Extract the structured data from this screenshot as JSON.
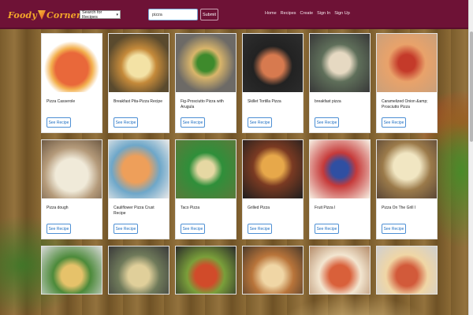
{
  "brand": {
    "part1": "Foody",
    "part2": "Corner"
  },
  "search": {
    "select_value": "Search for Recipes",
    "query": "pizza",
    "submit_label": "Submit"
  },
  "nav": [
    "Home",
    "Recipes",
    "Create",
    "Sign In",
    "Sign Up"
  ],
  "recipes": [
    {
      "title": "Pizza Casserole",
      "button": "See Recipe",
      "image_icon": "recipe-photo"
    },
    {
      "title": "Breakfast Pita-Pizza Recipe",
      "button": "See Recipe",
      "image_icon": "recipe-photo"
    },
    {
      "title": "Fig-Prosciutto Pizza with Arugula",
      "button": "See Recipe",
      "image_icon": "recipe-photo"
    },
    {
      "title": "Skillet Tortilla Pizza",
      "button": "See Recipe",
      "image_icon": "recipe-photo"
    },
    {
      "title": "breakfast pizza",
      "button": "See Recipe",
      "image_icon": "recipe-photo"
    },
    {
      "title": "Caramelized Onion &amp; Prosciutto Pizza",
      "button": "See Recipe",
      "image_icon": "recipe-photo"
    },
    {
      "title": "Pizza dough",
      "button": "See Recipe",
      "image_icon": "recipe-photo"
    },
    {
      "title": "Cauliflower Pizza Crust Recipe",
      "button": "See Recipe",
      "image_icon": "recipe-photo"
    },
    {
      "title": "Taco Pizza",
      "button": "See Recipe",
      "image_icon": "recipe-photo"
    },
    {
      "title": "Grilled Pizza",
      "button": "See Recipe",
      "image_icon": "recipe-photo"
    },
    {
      "title": "Fruit Pizza I",
      "button": "See Recipe",
      "image_icon": "recipe-photo"
    },
    {
      "title": "Pizza On The Grill I",
      "button": "See Recipe",
      "image_icon": "recipe-photo"
    }
  ],
  "colors": {
    "navbar": "#6e1236",
    "accent": "#f3a62a",
    "button": "#1f6fc2"
  }
}
